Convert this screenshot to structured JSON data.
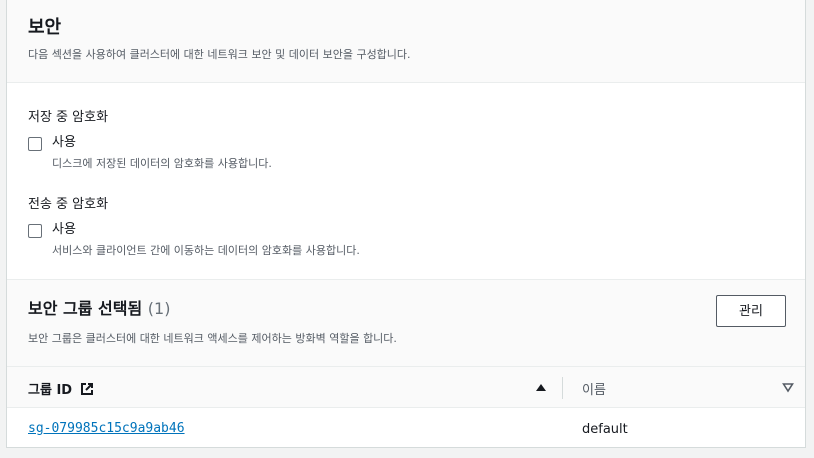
{
  "security": {
    "title": "보안",
    "description": "다음 섹션을 사용하여 클러스터에 대한 네트워크 보안 및 데이터 보안을 구성합니다."
  },
  "encryption_at_rest": {
    "label": "저장 중 암호화",
    "checkbox_label": "사용",
    "checkbox_desc": "디스크에 저장된 데이터의 암호화를 사용합니다.",
    "checked": false
  },
  "encryption_in_transit": {
    "label": "전송 중 암호화",
    "checkbox_label": "사용",
    "checkbox_desc": "서비스와 클라이언트 간에 이동하는 데이터의 암호화를 사용합니다.",
    "checked": false
  },
  "security_groups": {
    "title": "보안 그룹 선택됨",
    "count": "(1)",
    "description": "보안 그룹은 클러스터에 대한 네트워크 액세스를 제어하는 방화벽 역할을 합니다.",
    "manage_label": "관리",
    "columns": [
      "그룹 ID",
      "이름"
    ],
    "rows": [
      {
        "group_id": "sg-079985c15c9a9ab46",
        "name": "default"
      }
    ]
  },
  "icons": {
    "external_link": "external-link-icon",
    "sort_ascending": "caret-up-icon",
    "sort_descending": "caret-down-icon"
  },
  "colors": {
    "link": "#0073bb",
    "border": "#d5dbdb",
    "header_bg": "#fafafa"
  }
}
